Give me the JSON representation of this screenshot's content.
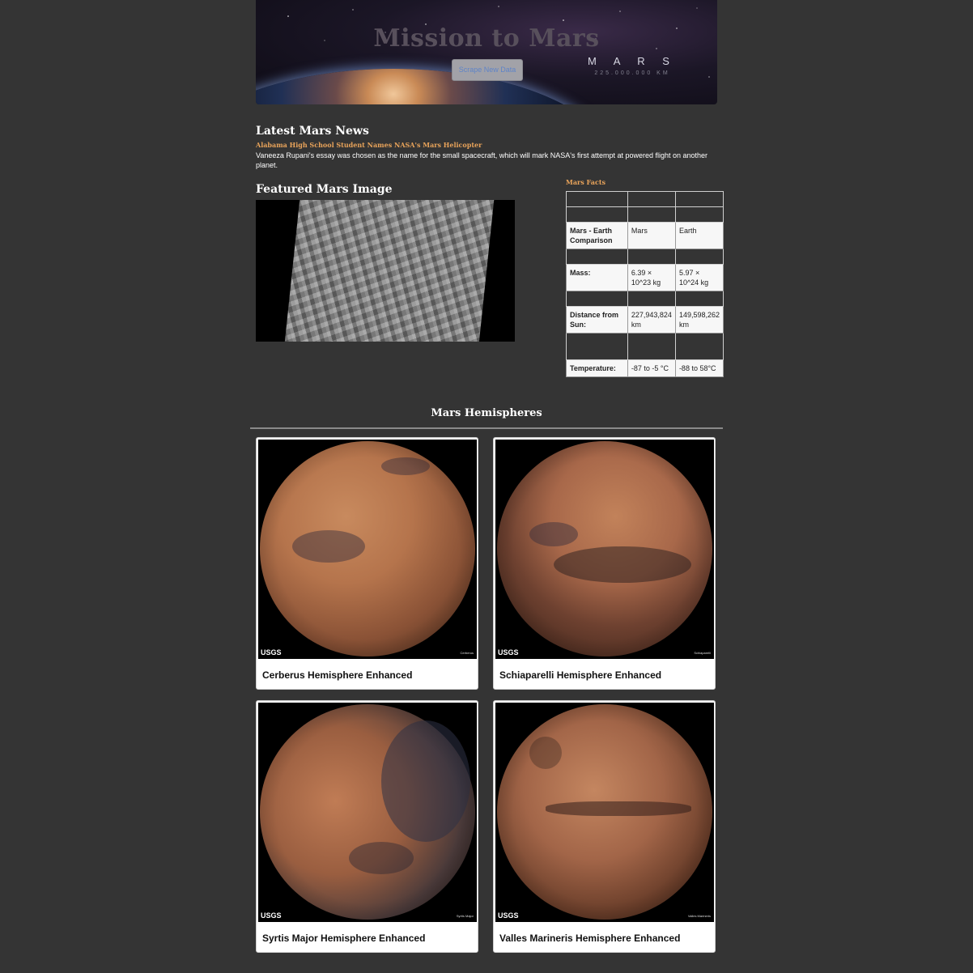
{
  "banner": {
    "title": "Mission to Mars",
    "scrape_button": "Scrape New Data",
    "planet_word": "M A R S",
    "planet_distance": "225.000.000 KM"
  },
  "news": {
    "heading": "Latest Mars News",
    "title": "Alabama High School Student Names NASA's Mars Helicopter",
    "body": "Vaneeza Rupani's essay was chosen as the name for the small spacecraft, which will mark NASA's first attempt at powered flight on another planet."
  },
  "featured": {
    "heading": "Featured Mars Image"
  },
  "facts": {
    "title": "Mars Facts",
    "rows": [
      {
        "label": "Mars - Earth Comparison",
        "mars": "Mars",
        "earth": "Earth"
      },
      {
        "label": "Mass:",
        "mars": "6.39 × 10^23 kg",
        "earth": "5.97 × 10^24 kg"
      },
      {
        "label": "Distance from Sun:",
        "mars": "227,943,824 km",
        "earth": "149,598,262 km"
      },
      {
        "label": "Temperature:",
        "mars": "-87 to -5 °C",
        "earth": "-88 to 58°C"
      }
    ]
  },
  "hemispheres": {
    "heading": "Mars Hemispheres",
    "items": [
      {
        "title": "Cerberus Hemisphere Enhanced",
        "logo": "USGS",
        "tag": "Cerberus"
      },
      {
        "title": "Schiaparelli Hemisphere Enhanced",
        "logo": "USGS",
        "tag": "Schiaparelli"
      },
      {
        "title": "Syrtis Major Hemisphere Enhanced",
        "logo": "USGS",
        "tag": "Syrtis Major"
      },
      {
        "title": "Valles Marineris Hemisphere Enhanced",
        "logo": "USGS",
        "tag": "Valles Marineris"
      }
    ]
  }
}
